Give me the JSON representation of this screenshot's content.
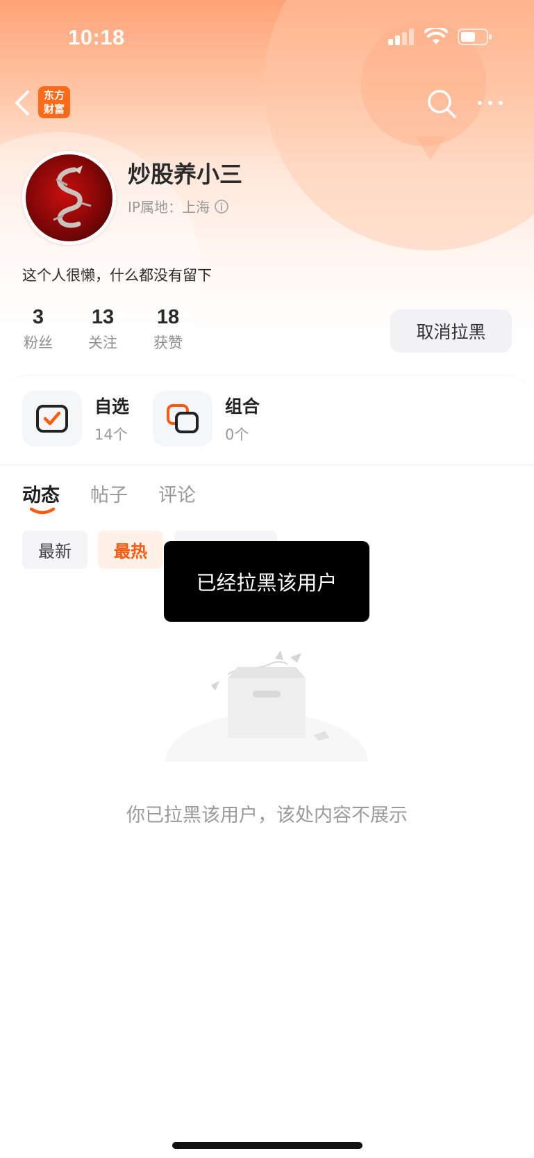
{
  "status_bar": {
    "time": "10:18"
  },
  "nav": {
    "logo_line1": "东方",
    "logo_line2": "财富"
  },
  "profile": {
    "username": "炒股养小三",
    "ip_label": "IP属地：上海",
    "bio": "这个人很懒，什么都没有留下",
    "stats": [
      {
        "value": "3",
        "label": "粉丝"
      },
      {
        "value": "13",
        "label": "关注"
      },
      {
        "value": "18",
        "label": "获赞"
      }
    ],
    "unblock_label": "取消拉黑"
  },
  "shortcuts": [
    {
      "title": "自选",
      "sub": "14个",
      "icon": "watchlist-icon"
    },
    {
      "title": "组合",
      "sub": "0个",
      "icon": "portfolio-icon"
    }
  ],
  "tabs": [
    {
      "label": "动态",
      "active": true
    },
    {
      "label": "帖子",
      "active": false
    },
    {
      "label": "评论",
      "active": false
    }
  ],
  "filters": {
    "newest": "最新",
    "hottest": "最热"
  },
  "toast": "已经拉黑该用户",
  "empty_state": {
    "message": "你已拉黑该用户，该处内容不展示"
  },
  "colors": {
    "brand_orange": "#ff6a1a",
    "accent_orange": "#ff5b0f"
  }
}
